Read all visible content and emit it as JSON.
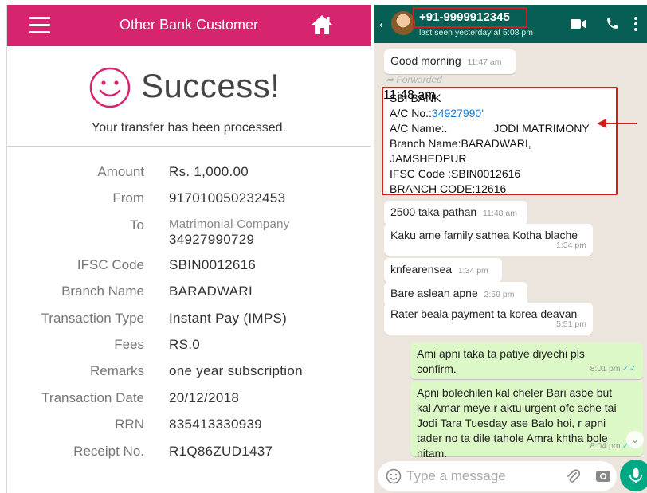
{
  "bank_app": {
    "header_title": "Other Bank Customer",
    "success_title": "Success!",
    "success_subtitle": "Your transfer has been processed.",
    "details": [
      {
        "label": "Amount",
        "value": "Rs. 1,000.00"
      },
      {
        "label": "From",
        "value": "917010050232453"
      },
      {
        "label": "To",
        "value_name": "Matrimonial Company",
        "value_account": "34927990729"
      },
      {
        "label": "IFSC Code",
        "value": "SBIN0012616"
      },
      {
        "label": "Branch Name",
        "value": "BARADWARI"
      },
      {
        "label": "Transaction Type",
        "value": "Instant Pay (IMPS)"
      },
      {
        "label": "Fees",
        "value": "RS.0"
      },
      {
        "label": "Remarks",
        "value": "one year subscription"
      },
      {
        "label": "Transaction Date",
        "value": "20/12/2018"
      },
      {
        "label": "RRN",
        "value": "835413330939"
      },
      {
        "label": "Receipt No.",
        "value": "R1Q86ZUD1437"
      }
    ],
    "colors": {
      "header": "#d6246e"
    }
  },
  "whatsapp": {
    "contact": "+91-9999912345",
    "last_seen": "last seen yesterday at 5:08 pm",
    "messages": [
      {
        "text": "Good morning",
        "time": "11:47 am"
      },
      {
        "forwarded_label": "Forwarded",
        "line1": "SBI BANK",
        "acno_label": "A/C No.:",
        "acno_value": "34927990'",
        "acname_label": "A/C Name:.",
        "acname_value": "JODI MATRIMONY",
        "branch_line1": "Branch Name:BARADWARI,",
        "branch_line2": "JAMSHEDPUR",
        "ifsc": "IFSC Code :SBIN0012616",
        "branch_code": "BRANCH CODE:12616",
        "time": "11:48 am"
      },
      {
        "text": "2500 taka pathan",
        "time": "11:48 am"
      },
      {
        "text": "Kaku ame family sathea Kotha blache",
        "time": "1:34 pm"
      },
      {
        "text": "knfearensea",
        "time": "1:34 pm"
      },
      {
        "text": "Bare aslean apne",
        "time": "2:59 pm"
      },
      {
        "text": "Rater beala payment ta korea deavan",
        "time": "5:51 pm"
      },
      {
        "line1": "Ami apni taka ta patiye diyechi pls",
        "line2": "confirm.",
        "time": "8:01 pm"
      },
      {
        "line1": "Apni bolechilen kal cheler Bari asbe but",
        "line2": "kal Amar meye r aktu urgent ofc ache tai",
        "line3": "Jodi Tara Tuesday ase Balo hoi, r apni",
        "line4": "tader no ta dile tahole Amra khtha bole",
        "line5": "nitam.",
        "time": "8:04 pm"
      }
    ],
    "input_placeholder": "Type a message",
    "colors": {
      "header": "#075e54",
      "outgoing_bubble": "#dcf8c6",
      "annotation": "#d01f1f"
    }
  }
}
